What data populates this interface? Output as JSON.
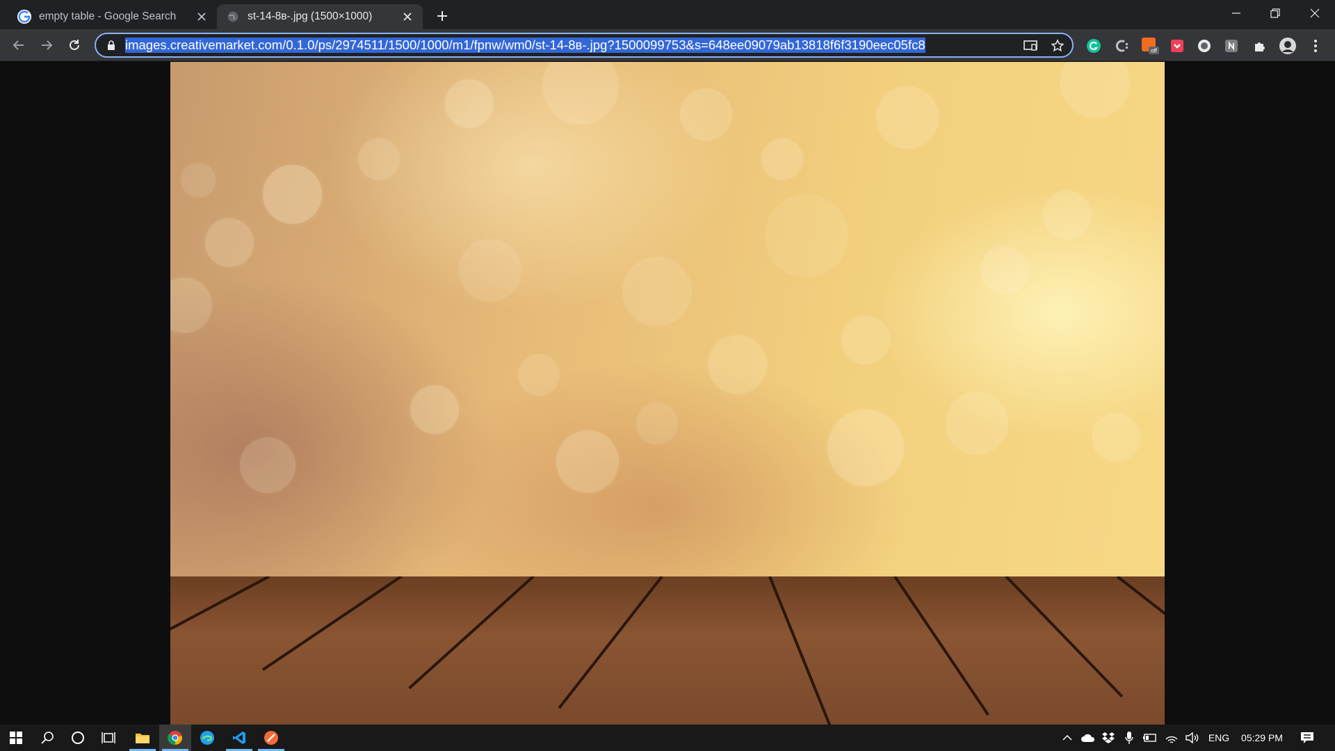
{
  "browser": {
    "tabs": [
      {
        "title": "empty table - Google Search",
        "favicon": "google-g-icon",
        "active": false
      },
      {
        "title": "st-14-8в-.jpg (1500×1000)",
        "favicon": "globe-icon",
        "active": true
      }
    ],
    "address_bar": {
      "url": "images.creativemarket.com/0.1.0/ps/2974511/1500/1000/m1/fpnw/wm0/st-14-8в-.jpg?1500099753&s=648ee09079ab13818f6f3190eec05fc8",
      "selected": true
    },
    "extensions": [
      {
        "name": "grammarly-icon",
        "color": "#15c39a"
      },
      {
        "name": "c-extension-icon",
        "color": "#bdc1c6"
      },
      {
        "name": "extension-off-icon",
        "color": "#f36b21",
        "badge": "off"
      },
      {
        "name": "pocket-icon",
        "color": "#ef4056"
      },
      {
        "name": "record-icon",
        "color": "#ffffff"
      },
      {
        "name": "n-extension-icon",
        "color": "#bdc1c6"
      },
      {
        "name": "puzzle-icon",
        "color": "#e8eaed"
      }
    ],
    "accent": "#8ab4f8",
    "selection_color": "#3367d6"
  },
  "viewer": {
    "image_description_colors": {
      "sky_top": "#f2cf7d",
      "bokeh_warm": "#fff3c4",
      "wood": "#7a4a2c"
    }
  },
  "taskbar": {
    "language": "ENG",
    "time": "05:29 PM",
    "apps": [
      "file-explorer-icon",
      "chrome-icon",
      "edge-icon",
      "vscode-icon",
      "orange-app-icon"
    ],
    "active_accent": "#76b9ed"
  }
}
